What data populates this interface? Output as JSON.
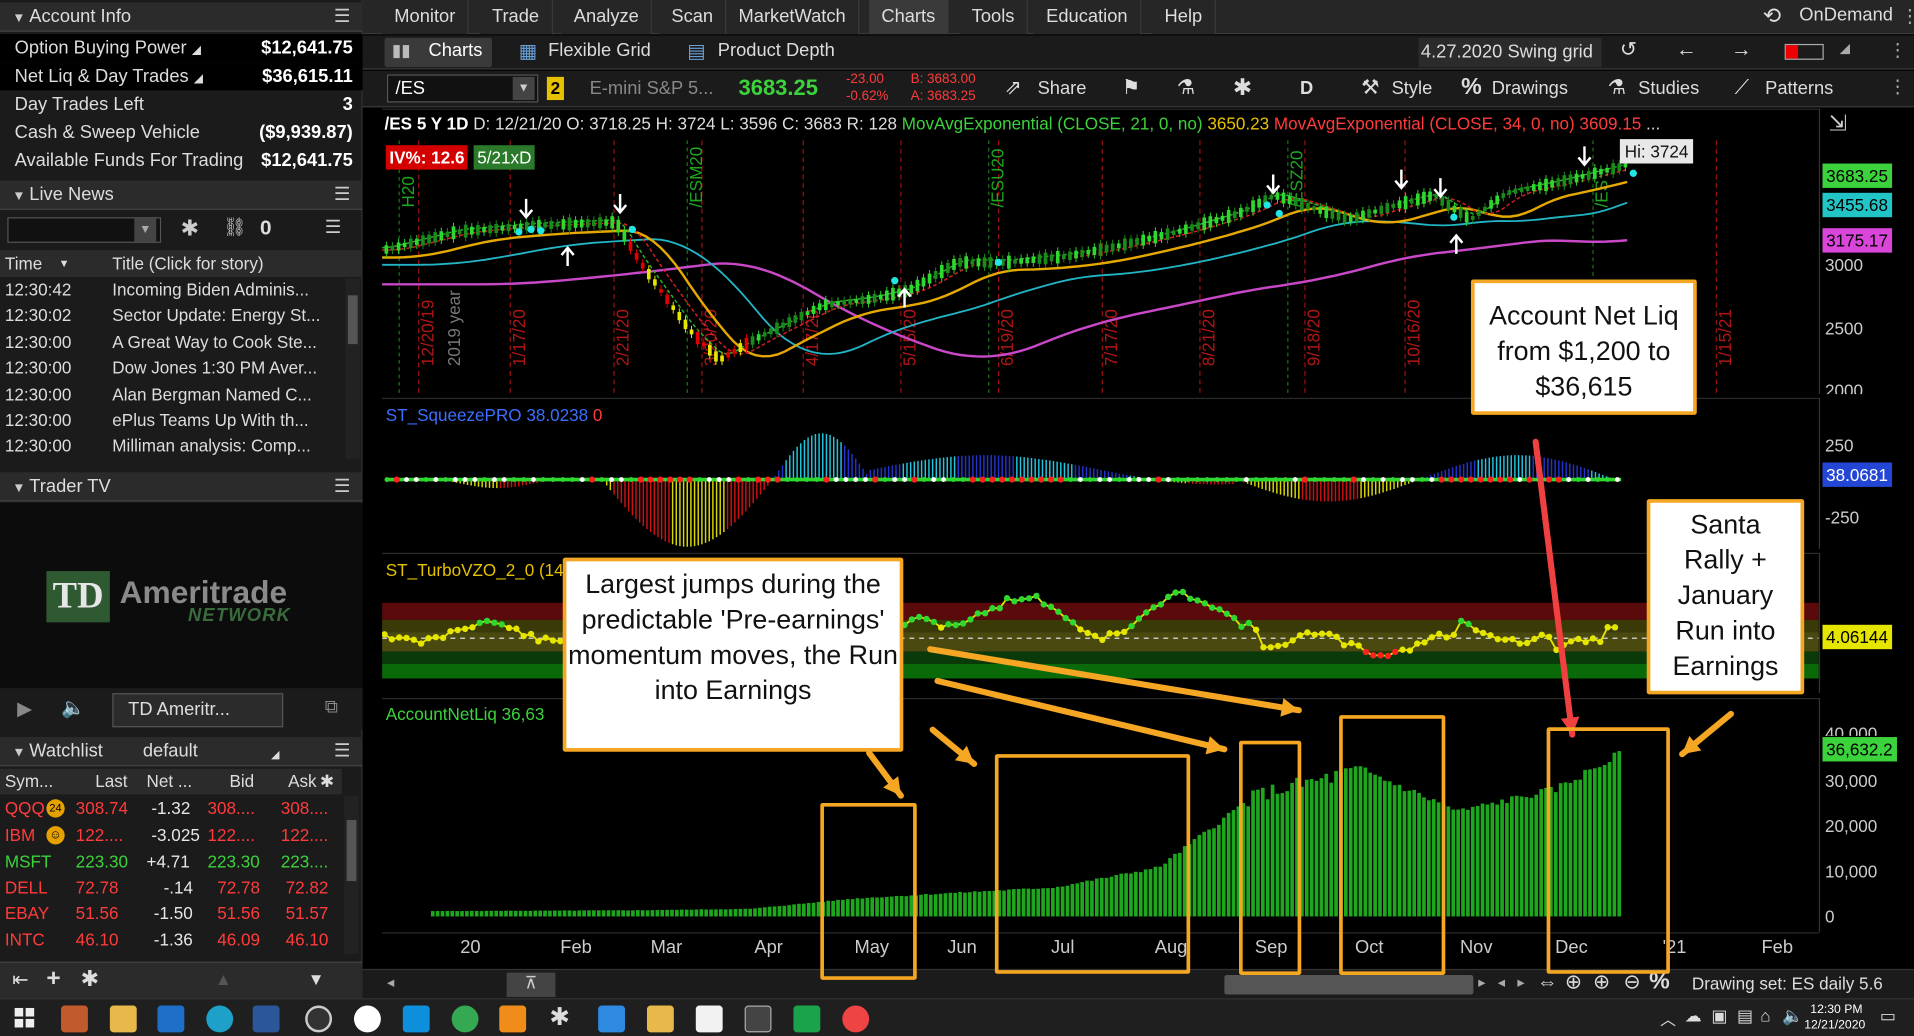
{
  "account_info": {
    "header": "Account Info",
    "rows": [
      {
        "label": "Option Buying Power",
        "value": "$12,641.75"
      },
      {
        "label": "Net Liq & Day Trades",
        "value": "$36,615.11"
      },
      {
        "label": "Day Trades Left",
        "value": "3"
      },
      {
        "label": "Cash & Sweep Vehicle",
        "value": "($9,939.87)"
      },
      {
        "label": "Available Funds For Trading",
        "value": "$12,641.75"
      }
    ]
  },
  "live_news": {
    "header": "Live News",
    "count": "0",
    "col_time": "Time",
    "col_title": "Title (Click for story)",
    "items": [
      {
        "time": "12:30:42",
        "title": "Incoming Biden Adminis..."
      },
      {
        "time": "12:30:02",
        "title": "Sector Update: Energy St..."
      },
      {
        "time": "12:30:00",
        "title": "A Great Way to Cook Ste..."
      },
      {
        "time": "12:30:00",
        "title": "Dow Jones 1:30 PM Aver..."
      },
      {
        "time": "12:30:00",
        "title": "Alan Bergman Named C..."
      },
      {
        "time": "12:30:00",
        "title": "ePlus Teams Up With th..."
      },
      {
        "time": "12:30:00",
        "title": "Milliman analysis: Comp..."
      }
    ]
  },
  "trader_tv": {
    "header": "Trader TV",
    "logo_line1": "Ameritrade",
    "logo_line2": "NETWORK",
    "logo_mark": "TD",
    "channel": "TD Ameritr..."
  },
  "watchlist": {
    "header": "Watchlist",
    "name": "default",
    "columns": [
      "Sym...",
      "Last",
      "Net ...",
      "Bid",
      "Ask"
    ],
    "rows": [
      {
        "sym": "QQQ",
        "last": "308.74",
        "net": "-1.32",
        "bid": "308....",
        "ask": "308....",
        "color": "red"
      },
      {
        "sym": "IBM",
        "last": "122....",
        "net": "-3.025",
        "bid": "122....",
        "ask": "122....",
        "color": "red"
      },
      {
        "sym": "MSFT",
        "last": "223.30",
        "net": "+4.71",
        "bid": "223.30",
        "ask": "223....",
        "color": "green"
      },
      {
        "sym": "DELL",
        "last": "72.78",
        "net": "-.14",
        "bid": "72.78",
        "ask": "72.82",
        "color": "red"
      },
      {
        "sym": "EBAY",
        "last": "51.56",
        "net": "-1.50",
        "bid": "51.56",
        "ask": "51.57",
        "color": "red"
      },
      {
        "sym": "INTC",
        "last": "46.10",
        "net": "-1.36",
        "bid": "46.09",
        "ask": "46.10",
        "color": "red"
      }
    ]
  },
  "menu": {
    "tabs": [
      "Monitor",
      "Trade",
      "Analyze",
      "Scan",
      "MarketWatch",
      "Charts",
      "Tools",
      "Education",
      "Help"
    ],
    "active": "Charts",
    "ondemand": "OnDemand"
  },
  "subtabs": {
    "charts": "Charts",
    "flexible_grid": "Flexible Grid",
    "product_depth": "Product Depth",
    "grid_name": "4.27.2020 Swing grid"
  },
  "chart_toolbar": {
    "symbol": "/ES",
    "link_num": "2",
    "description": "E-mini S&P 5...",
    "last": "3683.25",
    "change": "-23.00",
    "change_pct": "-0.62%",
    "bid": "B: 3683.00",
    "ask": "A: 3683.25",
    "share": "Share",
    "period": "D",
    "style": "Style",
    "drawings": "Drawings",
    "studies": "Studies",
    "patterns": "Patterns"
  },
  "price_panel": {
    "info": "/ES 5 Y 1D",
    "date": "D: 12/21/20",
    "open": "O: 3718.25",
    "high": "H: 3724",
    "low": "L: 3596",
    "close": "C: 3683",
    "range": "R: 128",
    "ema21": "MovAvgExponential (CLOSE, 21, 0, no)",
    "ema21_val": "3650.23",
    "ema34": "MovAvgExponential (CLOSE, 34, 0, no)",
    "ema34_val": "3609.15",
    "iv": "IV%: 12.6",
    "iv_days": "5/21xD",
    "hi_label": "Hi: 3724",
    "tag1": "3683.25",
    "tag2": "3455.68",
    "tag3": "3175.17",
    "y_ticks": [
      "3000",
      "2500",
      "2000"
    ],
    "vlines": [
      "12/20/19",
      "2019 year",
      "1/17/20",
      "2/21/20",
      "3/20/20",
      "4/17/20",
      "5/15/20",
      "6/19/20",
      "7/17/20",
      "8/21/20",
      "9/18/20",
      "10/16/20",
      "1/15/21"
    ],
    "contract_labels": [
      "H20",
      "/ESM20",
      "/ESU20",
      "/ESZ20",
      "/ES"
    ]
  },
  "squeeze_panel": {
    "name": "ST_SqueezePRO",
    "value": "38.0238",
    "value2": "0",
    "tag": "38.0681",
    "y_ticks": [
      "250",
      "-250"
    ]
  },
  "vzo_panel": {
    "name": "ST_TurboVZO_2_0 (14",
    "tag": "4.06144"
  },
  "netliq_panel": {
    "name": "AccountNetLiq",
    "value": "36,63",
    "tag": "36,632.2",
    "y_ticks": [
      "40,000",
      "30,000",
      "20,000",
      "10,000",
      "0"
    ]
  },
  "x_axis": [
    "20",
    "Feb",
    "Mar",
    "Apr",
    "May",
    "Jun",
    "Jul",
    "Aug",
    "Sep",
    "Oct",
    "Nov",
    "Dec",
    "'21",
    "Feb"
  ],
  "annotations": {
    "pre_earnings": "Largest jumps during the predictable 'Pre-earnings' momentum moves, the Run into Earnings",
    "net_liq": "Account Net Liq from $1,200 to $36,615",
    "santa": "Santa Rally + January Run into Earnings"
  },
  "bottom_bar": {
    "drawing_set": "Drawing set: ES daily 5.6"
  },
  "taskbar": {
    "time": "12:30 PM",
    "date": "12/21/2020"
  },
  "colors": {
    "accent_orange": "#f5a623",
    "green": "#3cd23c",
    "red": "#ff3b3b",
    "bar_green": "#1fa61f"
  },
  "chart_data": {
    "type": "bar",
    "series_label": "AccountNetLiq",
    "x": [
      "20",
      "Feb",
      "Mar",
      "Apr",
      "May",
      "Jun",
      "Jul",
      "Aug",
      "Sep",
      "Oct",
      "Nov",
      "Dec",
      "'21"
    ],
    "values": [
      1200,
      1300,
      1400,
      1700,
      4000,
      5200,
      6500,
      11000,
      27500,
      33000,
      23500,
      28500,
      36632
    ],
    "ylim": [
      0,
      40000
    ],
    "y_ticks": [
      0,
      10000,
      20000,
      30000,
      40000
    ]
  }
}
